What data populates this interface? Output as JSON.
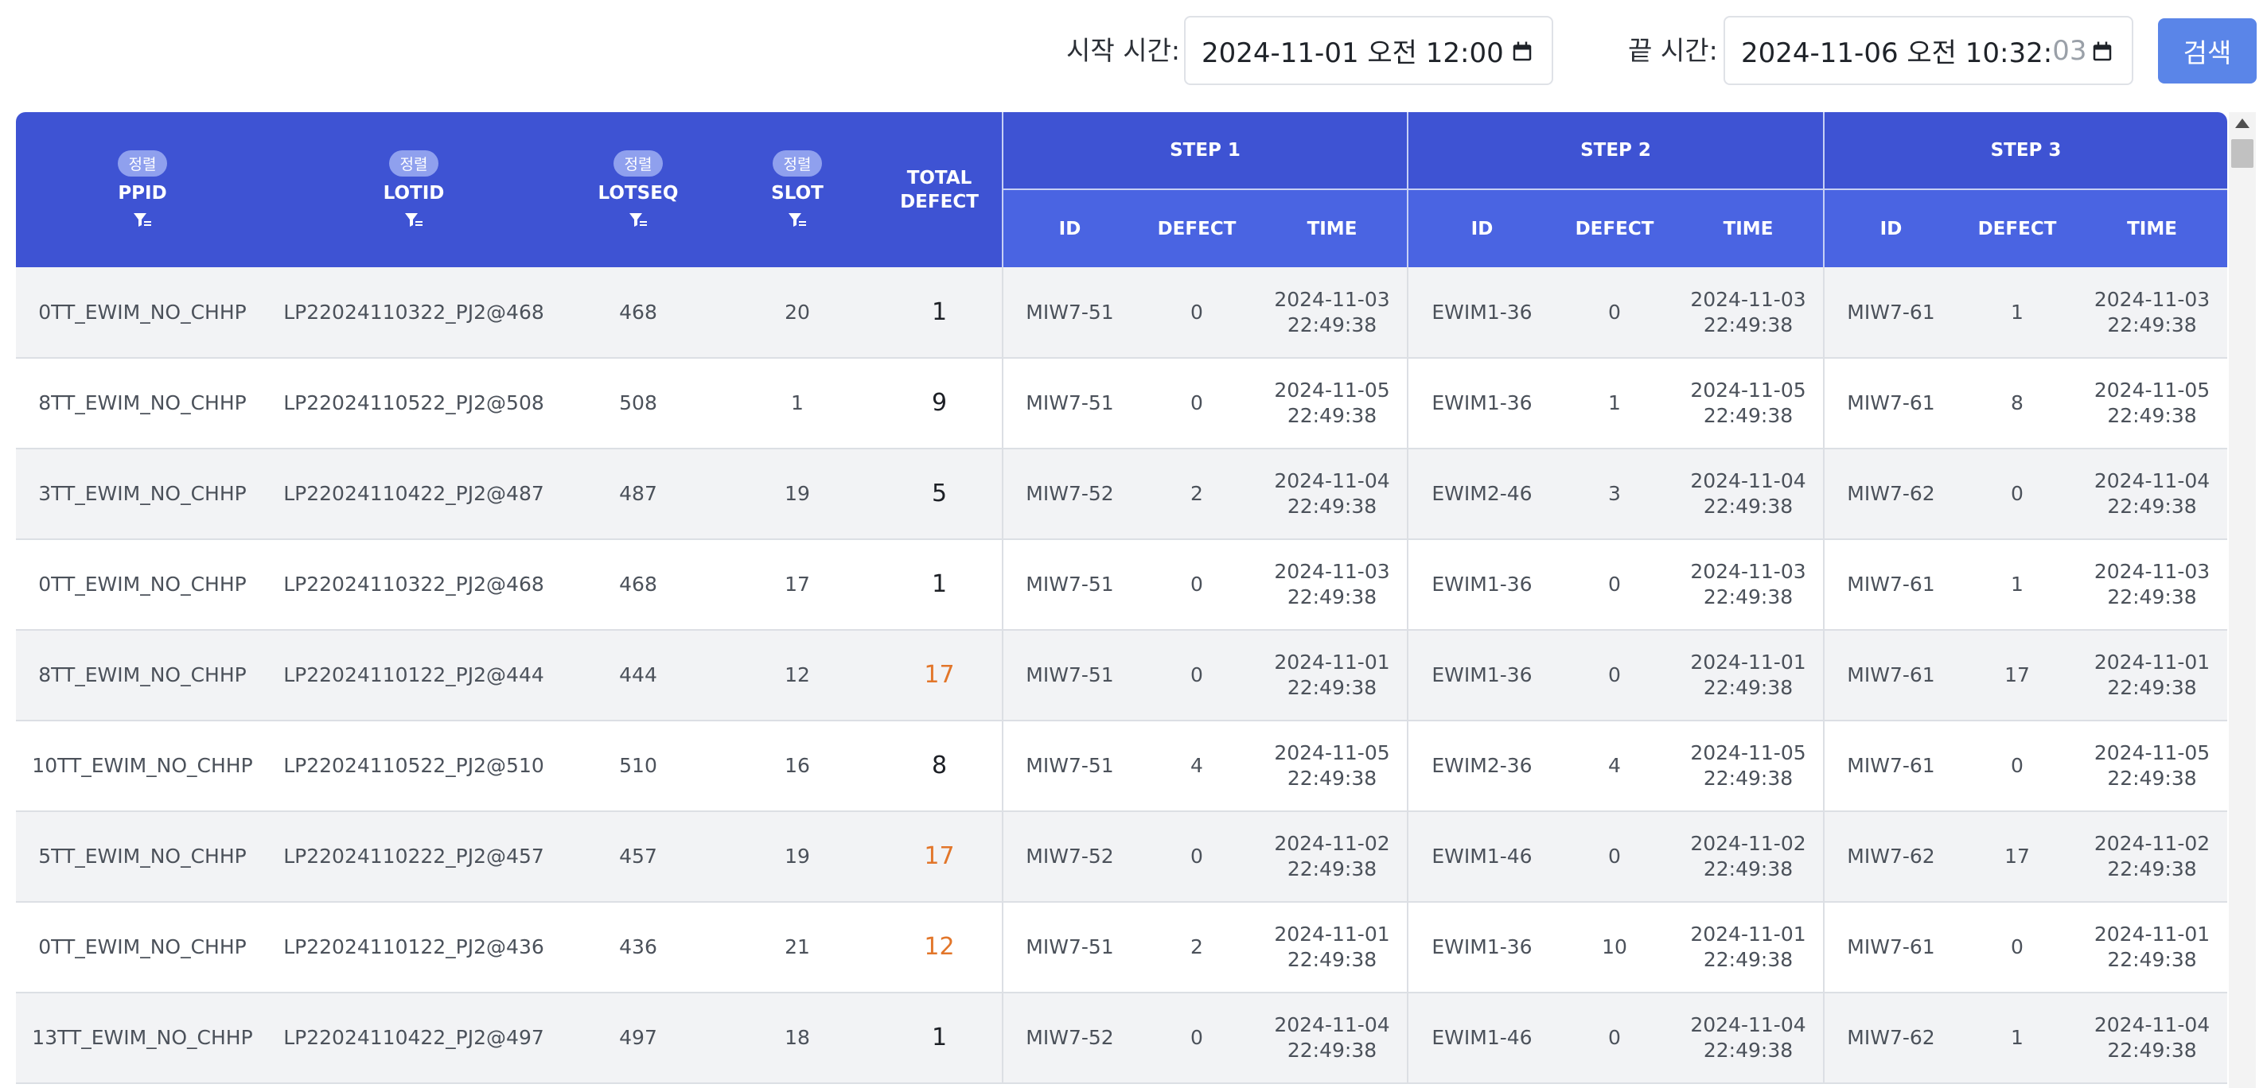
{
  "search": {
    "start_label": "시작 시간:",
    "start_value": "2024-11-01 오전 12:00",
    "start_value_dim": "",
    "end_label": "끝 시간:",
    "end_value": "2024-11-06 오전 10:32:",
    "end_value_dim": "03",
    "button_label": "검색"
  },
  "table": {
    "sort_badge": "정렬",
    "columns": {
      "ppid": "PPID",
      "lotid": "LOTID",
      "lotseq": "LOTSEQ",
      "slot": "SLOT",
      "total_line1": "TOTAL",
      "total_line2": "DEFECT",
      "step1": "STEP 1",
      "step2": "STEP 2",
      "step3": "STEP 3",
      "sub_id": "ID",
      "sub_defect": "DEFECT",
      "sub_time": "TIME"
    },
    "warn_color": "#e2762a",
    "header_color": "#3e53d3",
    "rows": [
      {
        "ppid": "0TT_EWIM_NO_CHHP",
        "lotid": "LP22024110322_PJ2@468",
        "lotseq": "468",
        "slot": "20",
        "total": "1",
        "warn": false,
        "s1": {
          "id": "MIW7-51",
          "defect": "0",
          "date": "2024-11-03",
          "time": "22:49:38"
        },
        "s2": {
          "id": "EWIM1-36",
          "defect": "0",
          "date": "2024-11-03",
          "time": "22:49:38"
        },
        "s3": {
          "id": "MIW7-61",
          "defect": "1",
          "date": "2024-11-03",
          "time": "22:49:38"
        }
      },
      {
        "ppid": "8TT_EWIM_NO_CHHP",
        "lotid": "LP22024110522_PJ2@508",
        "lotseq": "508",
        "slot": "1",
        "total": "9",
        "warn": false,
        "s1": {
          "id": "MIW7-51",
          "defect": "0",
          "date": "2024-11-05",
          "time": "22:49:38"
        },
        "s2": {
          "id": "EWIM1-36",
          "defect": "1",
          "date": "2024-11-05",
          "time": "22:49:38"
        },
        "s3": {
          "id": "MIW7-61",
          "defect": "8",
          "date": "2024-11-05",
          "time": "22:49:38"
        }
      },
      {
        "ppid": "3TT_EWIM_NO_CHHP",
        "lotid": "LP22024110422_PJ2@487",
        "lotseq": "487",
        "slot": "19",
        "total": "5",
        "warn": false,
        "s1": {
          "id": "MIW7-52",
          "defect": "2",
          "date": "2024-11-04",
          "time": "22:49:38"
        },
        "s2": {
          "id": "EWIM2-46",
          "defect": "3",
          "date": "2024-11-04",
          "time": "22:49:38"
        },
        "s3": {
          "id": "MIW7-62",
          "defect": "0",
          "date": "2024-11-04",
          "time": "22:49:38"
        }
      },
      {
        "ppid": "0TT_EWIM_NO_CHHP",
        "lotid": "LP22024110322_PJ2@468",
        "lotseq": "468",
        "slot": "17",
        "total": "1",
        "warn": false,
        "s1": {
          "id": "MIW7-51",
          "defect": "0",
          "date": "2024-11-03",
          "time": "22:49:38"
        },
        "s2": {
          "id": "EWIM1-36",
          "defect": "0",
          "date": "2024-11-03",
          "time": "22:49:38"
        },
        "s3": {
          "id": "MIW7-61",
          "defect": "1",
          "date": "2024-11-03",
          "time": "22:49:38"
        }
      },
      {
        "ppid": "8TT_EWIM_NO_CHHP",
        "lotid": "LP22024110122_PJ2@444",
        "lotseq": "444",
        "slot": "12",
        "total": "17",
        "warn": true,
        "s1": {
          "id": "MIW7-51",
          "defect": "0",
          "date": "2024-11-01",
          "time": "22:49:38"
        },
        "s2": {
          "id": "EWIM1-36",
          "defect": "0",
          "date": "2024-11-01",
          "time": "22:49:38"
        },
        "s3": {
          "id": "MIW7-61",
          "defect": "17",
          "date": "2024-11-01",
          "time": "22:49:38"
        }
      },
      {
        "ppid": "10TT_EWIM_NO_CHHP",
        "lotid": "LP22024110522_PJ2@510",
        "lotseq": "510",
        "slot": "16",
        "total": "8",
        "warn": false,
        "s1": {
          "id": "MIW7-51",
          "defect": "4",
          "date": "2024-11-05",
          "time": "22:49:38"
        },
        "s2": {
          "id": "EWIM2-36",
          "defect": "4",
          "date": "2024-11-05",
          "time": "22:49:38"
        },
        "s3": {
          "id": "MIW7-61",
          "defect": "0",
          "date": "2024-11-05",
          "time": "22:49:38"
        }
      },
      {
        "ppid": "5TT_EWIM_NO_CHHP",
        "lotid": "LP22024110222_PJ2@457",
        "lotseq": "457",
        "slot": "19",
        "total": "17",
        "warn": true,
        "s1": {
          "id": "MIW7-52",
          "defect": "0",
          "date": "2024-11-02",
          "time": "22:49:38"
        },
        "s2": {
          "id": "EWIM1-46",
          "defect": "0",
          "date": "2024-11-02",
          "time": "22:49:38"
        },
        "s3": {
          "id": "MIW7-62",
          "defect": "17",
          "date": "2024-11-02",
          "time": "22:49:38"
        }
      },
      {
        "ppid": "0TT_EWIM_NO_CHHP",
        "lotid": "LP22024110122_PJ2@436",
        "lotseq": "436",
        "slot": "21",
        "total": "12",
        "warn": true,
        "s1": {
          "id": "MIW7-51",
          "defect": "2",
          "date": "2024-11-01",
          "time": "22:49:38"
        },
        "s2": {
          "id": "EWIM1-36",
          "defect": "10",
          "date": "2024-11-01",
          "time": "22:49:38"
        },
        "s3": {
          "id": "MIW7-61",
          "defect": "0",
          "date": "2024-11-01",
          "time": "22:49:38"
        }
      },
      {
        "ppid": "13TT_EWIM_NO_CHHP",
        "lotid": "LP22024110422_PJ2@497",
        "lotseq": "497",
        "slot": "18",
        "total": "1",
        "warn": false,
        "s1": {
          "id": "MIW7-52",
          "defect": "0",
          "date": "2024-11-04",
          "time": "22:49:38"
        },
        "s2": {
          "id": "EWIM1-46",
          "defect": "0",
          "date": "2024-11-04",
          "time": "22:49:38"
        },
        "s3": {
          "id": "MIW7-62",
          "defect": "1",
          "date": "2024-11-04",
          "time": "22:49:38"
        }
      }
    ]
  }
}
